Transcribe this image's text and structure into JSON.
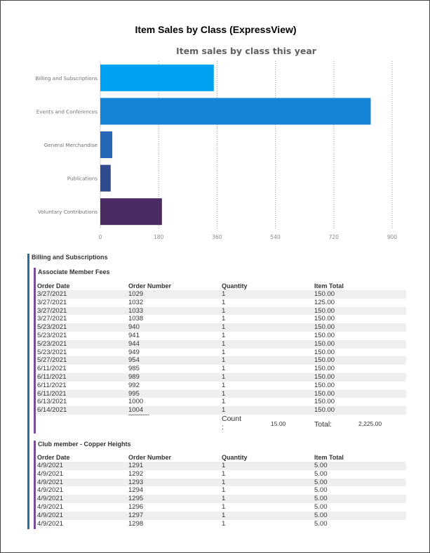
{
  "report": {
    "title": "Item Sales by Class (ExpressView)"
  },
  "chart_data": {
    "type": "bar",
    "orientation": "horizontal",
    "title": "Item sales by class this year",
    "categories": [
      "Billing and Subscriptions",
      "Events and Conferences",
      "General Merchandise",
      "Publications",
      "Voluntary Contributions"
    ],
    "values": [
      350,
      834,
      37,
      32,
      190
    ],
    "colors": [
      "#00a3f2",
      "#1584d6",
      "#2667b6",
      "#2f4a8f",
      "#4a2b63"
    ],
    "xlim": [
      0,
      900
    ],
    "xticks": [
      "0",
      "180",
      "360",
      "540",
      "720",
      "900"
    ],
    "xtick_values": [
      0,
      180,
      360,
      540,
      720,
      900
    ],
    "grid": "vertical dotted"
  },
  "section": {
    "title": "Billing and Subscriptions",
    "columns": [
      "Order Date",
      "Order Number",
      "Quantity",
      "Item Total"
    ],
    "groups": [
      {
        "title": "Associate Member Fees",
        "rows": [
          [
            "3/27/2021",
            "1029",
            "1",
            "150.00"
          ],
          [
            "3/27/2021",
            "1032",
            "1",
            "125.00"
          ],
          [
            "3/27/2021",
            "1033",
            "1",
            "150.00"
          ],
          [
            "3/27/2021",
            "1038",
            "1",
            "150.00"
          ],
          [
            "5/23/2021",
            "940",
            "1",
            "150.00"
          ],
          [
            "5/23/2021",
            "941",
            "1",
            "150.00"
          ],
          [
            "5/23/2021",
            "944",
            "1",
            "150.00"
          ],
          [
            "5/23/2021",
            "949",
            "1",
            "150.00"
          ],
          [
            "5/27/2021",
            "954",
            "1",
            "150.00"
          ],
          [
            "6/11/2021",
            "985",
            "1",
            "150.00"
          ],
          [
            "6/11/2021",
            "989",
            "1",
            "150.00"
          ],
          [
            "6/11/2021",
            "992",
            "1",
            "150.00"
          ],
          [
            "6/11/2021",
            "995",
            "1",
            "150.00"
          ],
          [
            "6/13/2021",
            "1000",
            "1",
            "150.00"
          ],
          [
            "6/14/2021",
            "1004",
            "1",
            "150.00"
          ]
        ],
        "count_label": "Count",
        "count_colon": ":",
        "count_value": "15.00",
        "total_label": "Total:",
        "total_value": "2,225.00"
      },
      {
        "title": "Club member - Copper Heights",
        "rows": [
          [
            "4/9/2021",
            "1291",
            "1",
            "5.00"
          ],
          [
            "4/9/2021",
            "1292",
            "1",
            "5.00"
          ],
          [
            "4/9/2021",
            "1293",
            "1",
            "5.00"
          ],
          [
            "4/9/2021",
            "1294",
            "1",
            "5.00"
          ],
          [
            "4/9/2021",
            "1295",
            "1",
            "5.00"
          ],
          [
            "4/9/2021",
            "1296",
            "1",
            "5.00"
          ],
          [
            "4/9/2021",
            "1297",
            "1",
            "5.00"
          ],
          [
            "4/9/2021",
            "1298",
            "1",
            "5.00"
          ]
        ]
      }
    ]
  }
}
